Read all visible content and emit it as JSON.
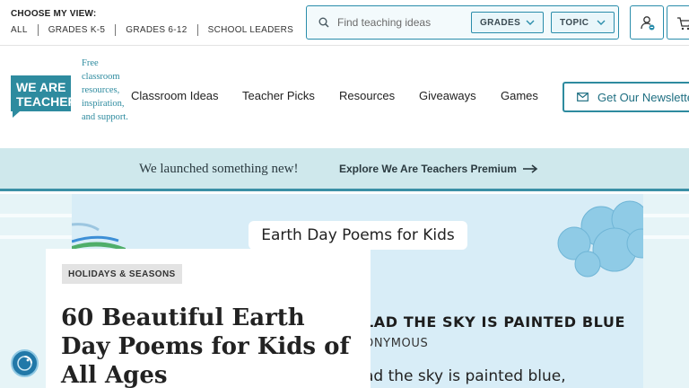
{
  "topbar": {
    "choose_label": "CHOOSE MY VIEW:",
    "grade_links": [
      "ALL",
      "GRADES K-5",
      "GRADES 6-12",
      "SCHOOL LEADERS"
    ]
  },
  "search": {
    "placeholder": "Find teaching ideas",
    "value": "",
    "grades_label": "GRADES",
    "topic_label": "TOPIC"
  },
  "header": {
    "logo_text": [
      "WE ARE",
      "TEACHERS"
    ],
    "tagline": "Free classroom resources, inspiration, and support.",
    "nav": [
      "Classroom Ideas",
      "Teacher Picks",
      "Resources",
      "Giveaways",
      "Games"
    ],
    "newsletter_label": "Get Our Newsletter"
  },
  "promo": {
    "text": "We launched something new!",
    "link": "Explore We Are Teachers Premium"
  },
  "hero": {
    "image_title": "Earth Day Poems for Kids",
    "poem_title": "LAD THE SKY IS PAINTED BLUE",
    "poem_author": "ONYMOUS",
    "poem_line": "ad the sky is painted blue,"
  },
  "article": {
    "category": "HOLIDAYS & SEASONS",
    "headline": "60 Beautiful Earth Day Poems for Kids of All Ages"
  },
  "colors": {
    "accent": "#2e8b9f",
    "promo_bg": "#cfe8ec",
    "hero_bg": "#d8edf7",
    "logo_bg": "#2e8b9f"
  },
  "icons": [
    "search-icon",
    "chevron-down-icon",
    "account-icon",
    "cart-icon",
    "mail-icon",
    "arrow-right-icon",
    "accessibility-icon"
  ]
}
